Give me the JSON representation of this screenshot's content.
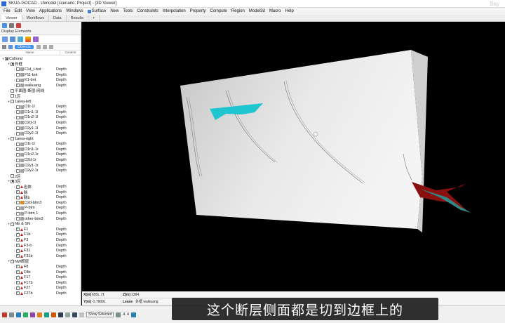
{
  "window": {
    "title": "SKUA-GOCAD - shmodel  [scenario: Project] - [3D Viewer]",
    "watermark": "Bay"
  },
  "menu": [
    {
      "label": "File"
    },
    {
      "label": "Edit"
    },
    {
      "label": "View"
    },
    {
      "label": "Applications"
    },
    {
      "label": "Windows"
    },
    {
      "label": "Surface",
      "icon": true
    },
    {
      "label": "New"
    },
    {
      "label": "Tools"
    },
    {
      "label": "Constraints"
    },
    {
      "label": "Interpolation"
    },
    {
      "label": "Property"
    },
    {
      "label": "Compute"
    },
    {
      "label": "Region"
    },
    {
      "label": "Model3d"
    },
    {
      "label": "Macro"
    },
    {
      "label": "Help"
    }
  ],
  "tabs": [
    {
      "label": "Viewer",
      "active": true
    },
    {
      "label": "Workflows",
      "active": false
    },
    {
      "label": "Data",
      "active": false
    },
    {
      "label": "Results",
      "active": false
    }
  ],
  "tab_add": "+",
  "panel": {
    "title": "Display Elements",
    "tabs": [
      {
        "label": "Objects",
        "active": true
      }
    ],
    "col_name": "Name",
    "col_content": "Content"
  },
  "tree": [
    {
      "label": "Cultural",
      "level": 0,
      "arrow": "v",
      "cb": "on",
      "kind": ""
    },
    {
      "label": "外框",
      "level": 1,
      "arrow": "v",
      "cb": "on",
      "kind": ""
    },
    {
      "label": "F1d_t-bot",
      "level": 2,
      "arrow": ">",
      "cb": "",
      "kind": "Depth",
      "ico": "gray"
    },
    {
      "label": "F11-bot",
      "level": 2,
      "arrow": ">",
      "cb": "",
      "kind": "Depth",
      "ico": "gray"
    },
    {
      "label": "K1-bot",
      "level": 2,
      "arrow": ">",
      "cb": "",
      "kind": "Depth",
      "ico": "gray"
    },
    {
      "label": "waikuang",
      "level": 2,
      "arrow": ">",
      "cb": "check",
      "kind": "Depth",
      "ico": "gray"
    },
    {
      "label": "平面图-断层-网线",
      "level": 1,
      "arrow": ">",
      "cb": "",
      "kind": ""
    },
    {
      "label": "1区",
      "level": 1,
      "arrow": "",
      "cb": "",
      "kind": ""
    },
    {
      "label": "1area-left",
      "level": 1,
      "arrow": "v",
      "cb": "",
      "kind": ""
    },
    {
      "label": "D1t-1l",
      "level": 2,
      "arrow": ">",
      "cb": "",
      "kind": "Depth",
      "ico": "gray"
    },
    {
      "label": "D1n1-1l",
      "level": 2,
      "arrow": ">",
      "cb": "",
      "kind": "Depth",
      "ico": "gray"
    },
    {
      "label": "D1n2-1l",
      "level": 2,
      "arrow": ">",
      "cb": "",
      "kind": "Depth",
      "ico": "gray"
    },
    {
      "label": "D2d-1l",
      "level": 2,
      "arrow": ">",
      "cb": "",
      "kind": "Depth",
      "ico": "gray"
    },
    {
      "label": "D2y1-1l",
      "level": 2,
      "arrow": ">",
      "cb": "",
      "kind": "Depth",
      "ico": "gray"
    },
    {
      "label": "D2y2-1l",
      "level": 2,
      "arrow": ">",
      "cb": "",
      "kind": "Depth",
      "ico": "gray"
    },
    {
      "label": "1area-right",
      "level": 1,
      "arrow": "v",
      "cb": "",
      "kind": ""
    },
    {
      "label": "D1t-1r",
      "level": 2,
      "arrow": ">",
      "cb": "",
      "kind": "Depth",
      "ico": "gray"
    },
    {
      "label": "D1n1-1r",
      "level": 2,
      "arrow": ">",
      "cb": "",
      "kind": "Depth",
      "ico": "gray"
    },
    {
      "label": "D1n2-1r",
      "level": 2,
      "arrow": ">",
      "cb": "",
      "kind": "Depth",
      "ico": "gray"
    },
    {
      "label": "D2d-1r",
      "level": 2,
      "arrow": ">",
      "cb": "",
      "kind": "Depth",
      "ico": "gray"
    },
    {
      "label": "D2y1-1r",
      "level": 2,
      "arrow": ">",
      "cb": "",
      "kind": "Depth",
      "ico": "gray"
    },
    {
      "label": "D2y2-1r",
      "level": 2,
      "arrow": ">",
      "cb": "",
      "kind": "Depth",
      "ico": "gray"
    },
    {
      "label": "2区",
      "level": 1,
      "arrow": ">",
      "cb": "",
      "kind": ""
    },
    {
      "label": "3区",
      "level": 1,
      "arrow": "v",
      "cb": "on",
      "kind": ""
    },
    {
      "label": "岩体",
      "level": 2,
      "arrow": ">",
      "cb": "check",
      "kind": "Depth",
      "ico": "tri"
    },
    {
      "label": "脉",
      "level": 2,
      "arrow": ">",
      "cb": "check",
      "kind": "Depth",
      "ico": "tri"
    },
    {
      "label": "脉b",
      "level": 2,
      "arrow": ">",
      "cb": "check",
      "kind": "Depth",
      "ico": "tri"
    },
    {
      "label": "D2d-btm3",
      "level": 2,
      "arrow": ">",
      "cb": "",
      "kind": "Depth",
      "ico": "orange"
    },
    {
      "label": "P-btm",
      "level": 2,
      "arrow": ">",
      "cb": "",
      "kind": "Depth",
      "ico": "gray"
    },
    {
      "label": "P-btm 1",
      "level": 2,
      "arrow": ">",
      "cb": "",
      "kind": "Depth",
      "ico": "gray"
    },
    {
      "label": "other-btm3",
      "level": 2,
      "arrow": ">",
      "cb": "",
      "kind": "Depth",
      "ico": "gray"
    },
    {
      "label": "NE & SN",
      "level": 1,
      "arrow": "v",
      "cb": "check",
      "kind": ""
    },
    {
      "label": "F1",
      "level": 2,
      "arrow": ">",
      "cb": "check",
      "kind": "Depth",
      "ico": "tri"
    },
    {
      "label": "F1b",
      "level": 2,
      "arrow": ">",
      "cb": "check",
      "kind": "Depth",
      "ico": "tri"
    },
    {
      "label": "F3",
      "level": 2,
      "arrow": ">",
      "cb": "check",
      "kind": "Depth",
      "ico": "tri"
    },
    {
      "label": "F3-b",
      "level": 2,
      "arrow": ">",
      "cb": "check",
      "kind": "Depth",
      "ico": "tri"
    },
    {
      "label": "F31",
      "level": 2,
      "arrow": ">",
      "cb": "check",
      "kind": "Depth",
      "ico": "tri"
    },
    {
      "label": "F31b",
      "level": 2,
      "arrow": ">",
      "cb": "check",
      "kind": "Depth",
      "ico": "tri"
    },
    {
      "label": "NW断层",
      "level": 1,
      "arrow": "v",
      "cb": "check",
      "kind": ""
    },
    {
      "label": "F8",
      "level": 2,
      "arrow": ">",
      "cb": "check",
      "kind": "Depth",
      "ico": "tri"
    },
    {
      "label": "F8b",
      "level": 2,
      "arrow": ">",
      "cb": "check",
      "kind": "Depth",
      "ico": "tri"
    },
    {
      "label": "F17",
      "level": 2,
      "arrow": ">",
      "cb": "check",
      "kind": "Depth",
      "ico": "tri"
    },
    {
      "label": "F17b",
      "level": 2,
      "arrow": ">",
      "cb": "check",
      "kind": "Depth",
      "ico": "tri"
    },
    {
      "label": "F27",
      "level": 2,
      "arrow": ">",
      "cb": "check",
      "kind": "Depth",
      "ico": "tri"
    },
    {
      "label": "F27b",
      "level": 2,
      "arrow": ">",
      "cb": "check",
      "kind": "Depth",
      "ico": "tri"
    }
  ],
  "status": {
    "x_key": "X[m]",
    "x_val": "605L.71",
    "z_key": "Z[m]",
    "z_val": "1384",
    "y_key": "Y[m]",
    "y_val": "-1.7909L",
    "label_key": "Lease",
    "label_val": "外框 waikuang"
  },
  "bottom": {
    "select_label": "Show Selected",
    "num1": "4",
    "num2": "4"
  },
  "subtitle": "这个断层侧面都是切到边框上的",
  "colors": {
    "fault_cyan": "#1fc6d1",
    "fault_red": "#8b1010",
    "box": "#d9d9d9",
    "accent": "#3d8ee8"
  }
}
